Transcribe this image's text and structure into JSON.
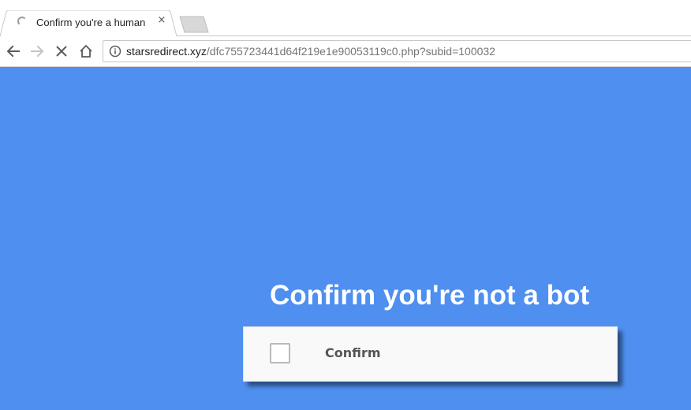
{
  "browser": {
    "tab": {
      "title": "Confirm you're a human",
      "close_glyph": "×",
      "status_icon": "loading-spinner-icon"
    },
    "new_tab_icon": "new-tab-icon",
    "toolbar": {
      "back_icon": "back-arrow-icon",
      "forward_icon": "forward-arrow-icon",
      "stop_icon": "stop-x-icon",
      "home_icon": "home-icon",
      "info_icon": "info-icon"
    },
    "address": {
      "host": "starsredirect.xyz",
      "path": "/dfc755723441d64f219e1e90053119c0.php?subid=100032"
    }
  },
  "page": {
    "background_color": "#4f8fef",
    "heading": "Confirm you're not a bot",
    "confirm_box": {
      "label": "Confirm",
      "checked": false
    }
  }
}
